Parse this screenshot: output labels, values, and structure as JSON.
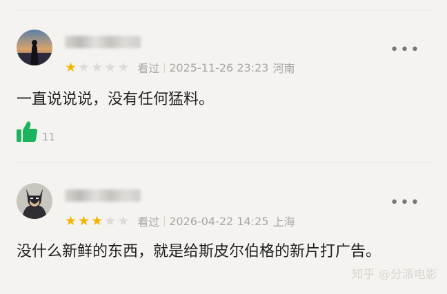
{
  "reviews": [
    {
      "rating": 1,
      "status": "看过",
      "datetime": "2025-11-26 23:23",
      "location": "河南",
      "comment": "一直说说说，没有任何猛料。",
      "likes": "11",
      "avatar": "silhouette-photo-avatar"
    },
    {
      "rating": 3,
      "status": "看过",
      "datetime": "2026-04-22 14:25",
      "location": "上海",
      "comment": "没什么新鲜的东西，就是给斯皮尔伯格的新片打广告。",
      "avatar": "batman-avatar"
    }
  ],
  "more_label": "•••",
  "star_glyph": "★",
  "watermark": "知乎 @分派电影",
  "colors": {
    "star": "#f5b400",
    "like": "#1bb35d",
    "meta": "#a8a6a3"
  }
}
